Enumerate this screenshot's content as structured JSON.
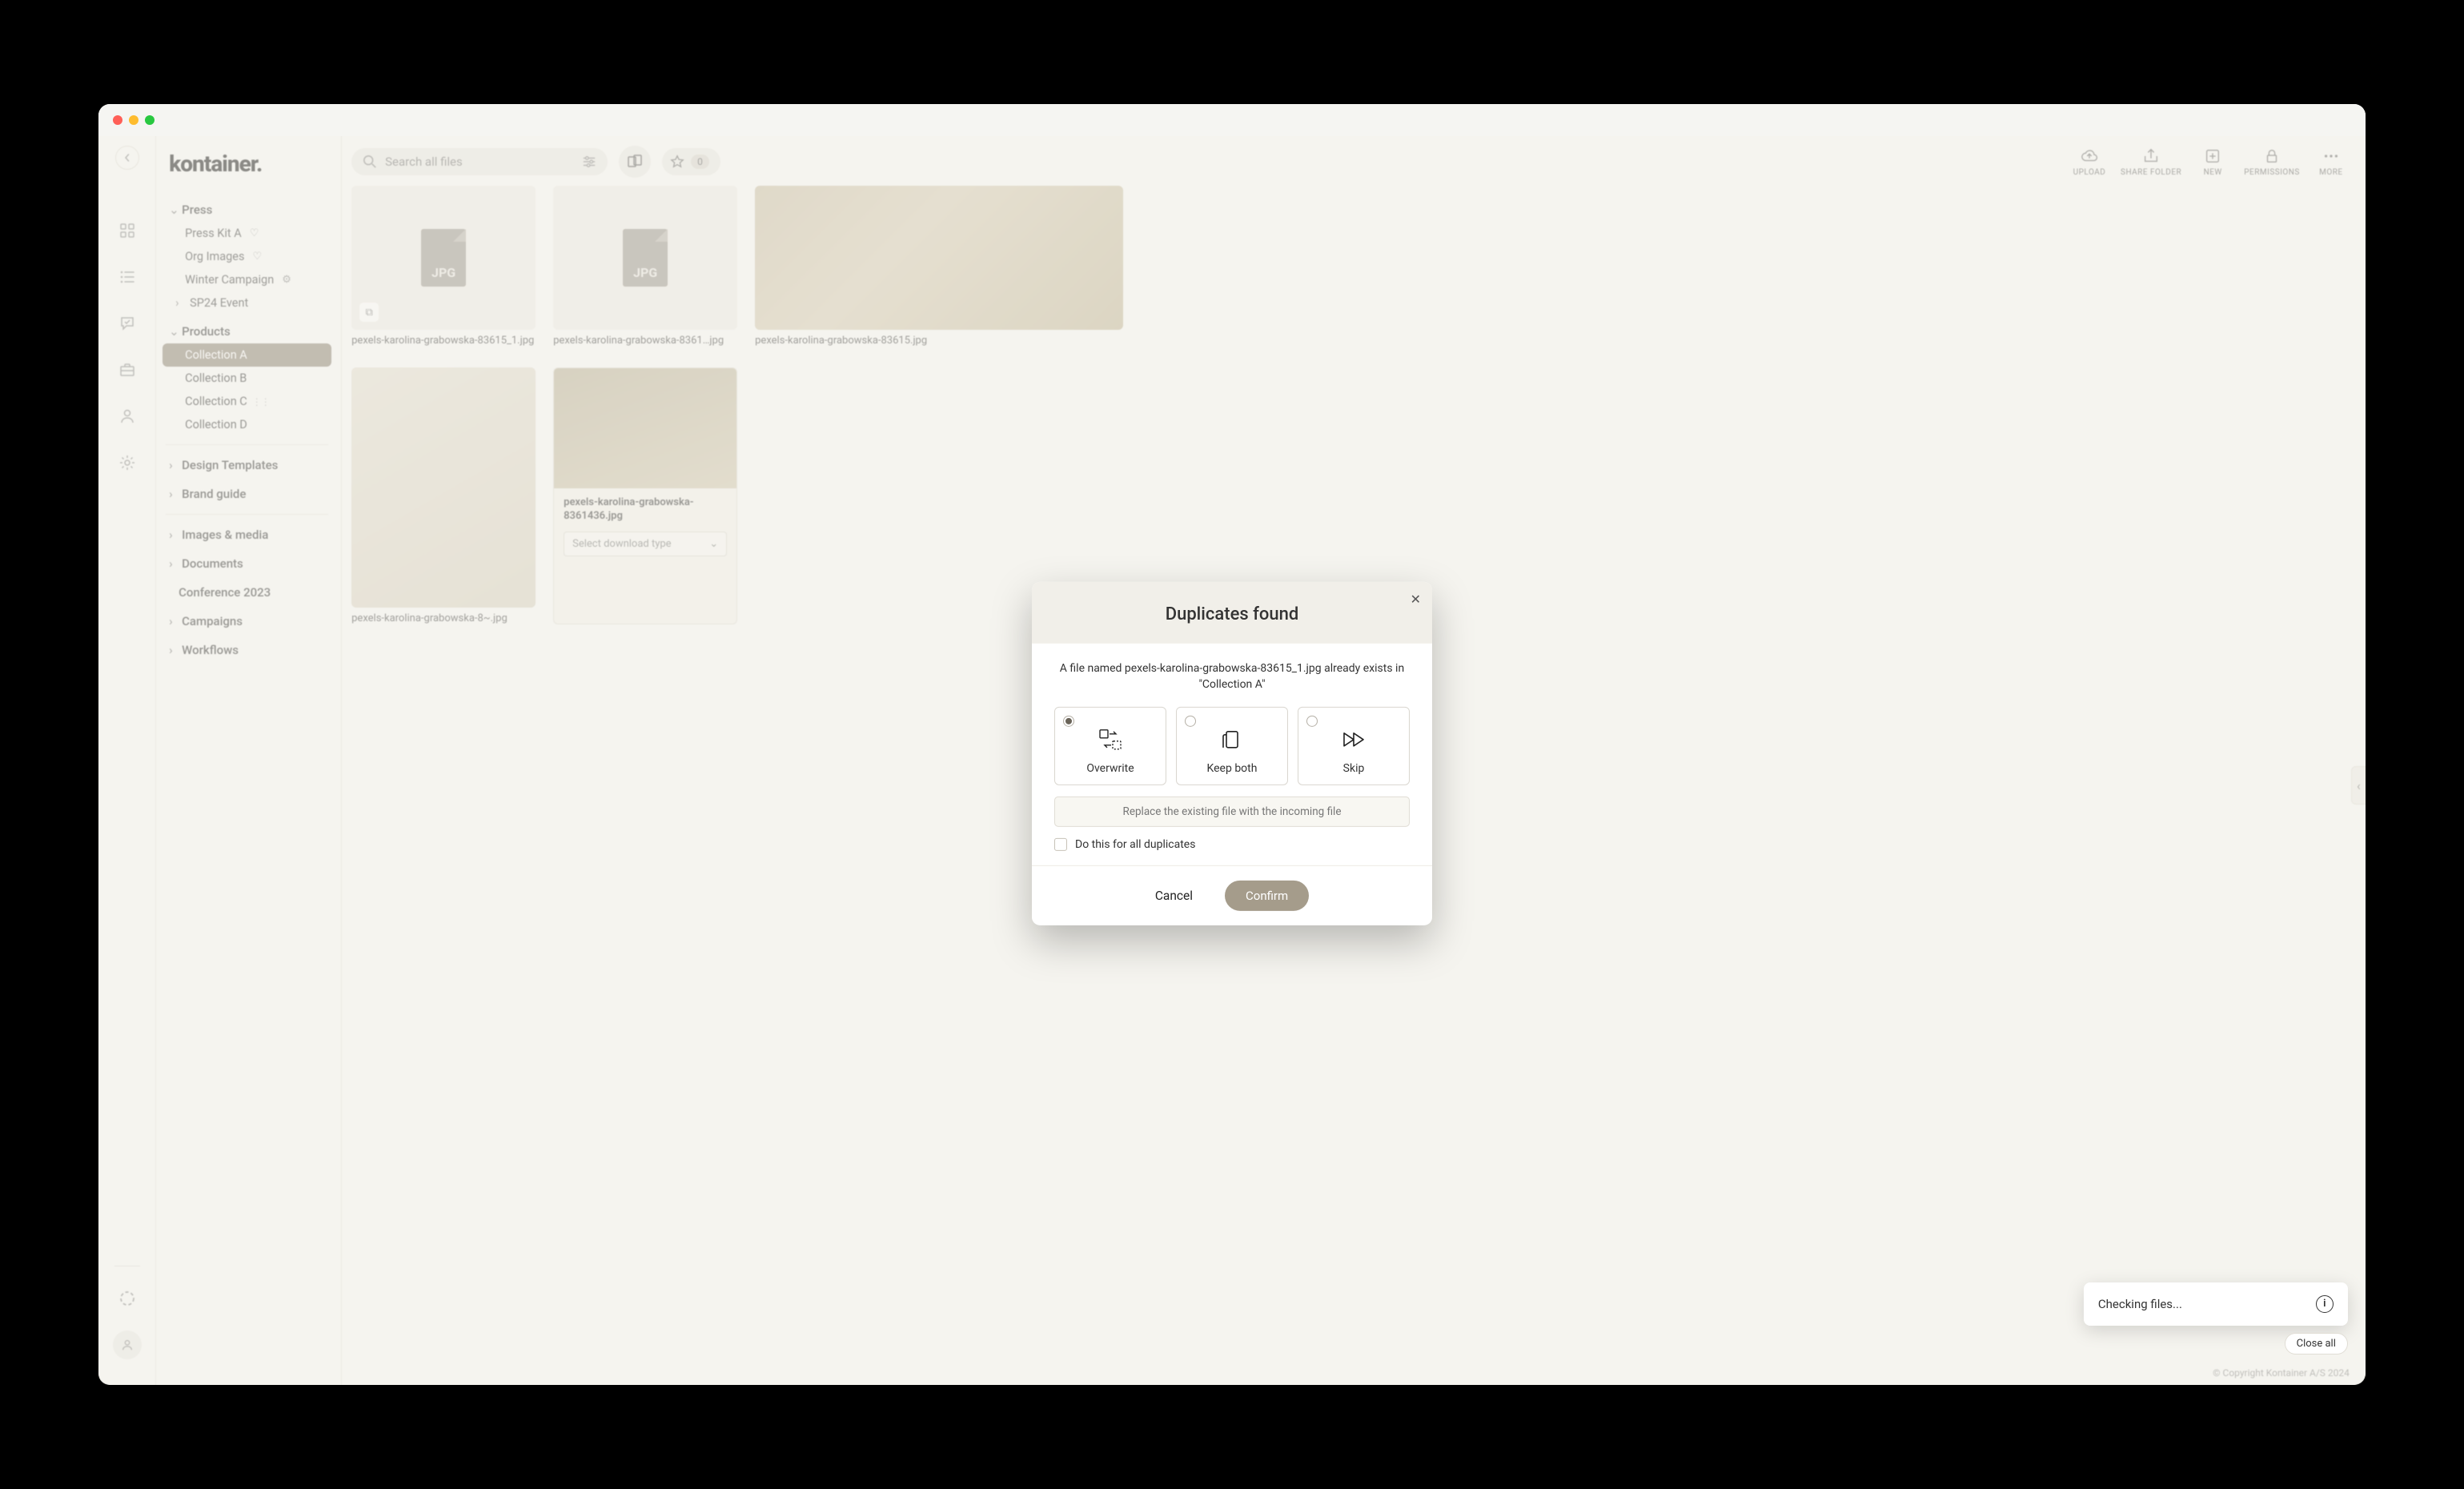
{
  "brand": "kontainer.",
  "search": {
    "placeholder": "Search all files"
  },
  "star": {
    "count": "0"
  },
  "actions": {
    "upload": "UPLOAD",
    "share": "SHARE FOLDER",
    "new": "NEW",
    "permissions": "PERMISSIONS",
    "more": "MORE"
  },
  "tree": {
    "press": "Press",
    "press_kit": "Press Kit A",
    "org_images": "Org Images",
    "winter": "Winter Campaign",
    "sp24": "SP24 Event",
    "products": "Products",
    "col_a": "Collection A",
    "col_b": "Collection B",
    "col_c": "Collection C",
    "col_d": "Collection D",
    "design": "Design Templates",
    "brand": "Brand guide",
    "images": "Images & media",
    "documents": "Documents",
    "conf": "Conference 2023",
    "campaigns": "Campaigns",
    "workflows": "Workflows"
  },
  "files": {
    "f1": "pexels-karolina-grabowska-83615_1.jpg",
    "f1_ext": "JPG",
    "f2": "pexels-karolina-grabowska-8361…jpg",
    "f2_ext": "JPG",
    "f3": "pexels-karolina-grabowska-83615.jpg",
    "f4": "pexels-karolina-grabowska-8~.jpg",
    "f5": "pexels-karolina-grabowska-8361436.jpg",
    "dl_placeholder": "Select download type"
  },
  "modal": {
    "title": "Duplicates found",
    "msg_a": "A file named pexels-karolina-grabowska-83615_1.jpg already exists in",
    "msg_b": "\"Collection A\"",
    "overwrite": "Overwrite",
    "keep": "Keep both",
    "skip": "Skip",
    "hint": "Replace the existing file with the incoming file",
    "all": "Do this for all duplicates",
    "cancel": "Cancel",
    "confirm": "Confirm"
  },
  "toast": {
    "msg": "Checking files..."
  },
  "closeall": "Close all",
  "footer": "© Copyright Kontainer A/S 2024"
}
